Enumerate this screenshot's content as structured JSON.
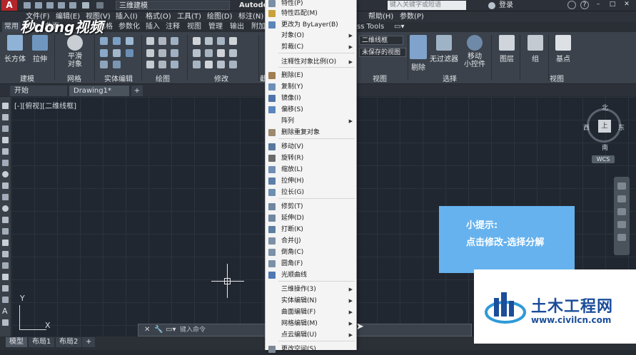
{
  "titlebar": {
    "app_logo": "A",
    "workspace": "三维建模",
    "app_title": "Autodesk",
    "search_placeholder": "键入关键字或短语",
    "login": "登录",
    "icons": [
      "new-file-icon",
      "open-icon",
      "save-icon",
      "save-as-icon",
      "print-icon",
      "undo-icon",
      "redo-icon"
    ]
  },
  "menubar": {
    "items": [
      "文件(F)",
      "编辑(E)",
      "视图(V)",
      "插入(I)",
      "格式(O)",
      "工具(T)",
      "绘图(D)",
      "标注(N)",
      "帮助(H)",
      "参数(P)"
    ]
  },
  "ribbon_tabs": {
    "items": [
      "常用",
      "实体",
      "曲面",
      "网格",
      "参数化",
      "插入",
      "注释",
      "视图",
      "管理",
      "输出",
      "附加"
    ],
    "trailing": "ss Tools"
  },
  "ribbon": {
    "buttons": {
      "box": "长方体",
      "extrude": "拉伸",
      "smooth": "平滑\n对象",
      "cut": "剖切",
      "no_filter": "无过滤器",
      "gizmo": "移动\n小控件",
      "layers": "图层",
      "group": "组",
      "base_point": "基点"
    },
    "panels": [
      "建模",
      "网格",
      "实体编辑",
      "绘图",
      "修改",
      "截",
      "视图",
      "选择",
      "视图"
    ],
    "visual_style": "二维线框",
    "saved_view": "未保存的视图"
  },
  "doctabs": {
    "start": "开始",
    "drawing": "Drawing1*",
    "new": "+"
  },
  "viewport": {
    "label": "[-][俯视][二维线框]",
    "compass": {
      "n": "北",
      "s": "南",
      "e": "东",
      "w": "西"
    },
    "cube_face": "上",
    "wcs": "WCS",
    "ucs_x": "X",
    "ucs_y": "Y"
  },
  "cmdline": {
    "placeholder": "键入命令"
  },
  "layout_tabs": {
    "items": [
      "模型",
      "布局1",
      "布局2",
      "+"
    ]
  },
  "tip": {
    "title": "小提示:",
    "text": "点击修改-选择分解"
  },
  "watermark": {
    "top_left": "秒dong视频",
    "site_name": "土木工程网",
    "site_url": "www.civilcn.com"
  },
  "context_menu": {
    "items": [
      {
        "label": "特性(P)",
        "icon": "properties-icon"
      },
      {
        "label": "特性匹配(M)",
        "icon": "match-properties-icon"
      },
      {
        "label": "更改为 ByLayer(B)",
        "icon": "bylayer-icon"
      },
      {
        "label": "对象(O)",
        "submenu": true
      },
      {
        "label": "剪裁(C)",
        "submenu": true
      },
      {
        "label": "注释性对象比例(O)",
        "submenu": true
      },
      {
        "label": "删除(E)",
        "icon": "erase-icon"
      },
      {
        "label": "复制(Y)",
        "icon": "copy-icon"
      },
      {
        "label": "镜像(I)",
        "icon": "mirror-icon"
      },
      {
        "label": "偏移(S)",
        "icon": "offset-icon"
      },
      {
        "label": "阵列",
        "submenu": true
      },
      {
        "label": "删除重复对象",
        "icon": "overkill-icon"
      },
      {
        "label": "移动(V)",
        "icon": "move-icon"
      },
      {
        "label": "旋转(R)",
        "icon": "rotate-icon"
      },
      {
        "label": "缩放(L)",
        "icon": "scale-icon"
      },
      {
        "label": "拉伸(H)",
        "icon": "stretch-icon"
      },
      {
        "label": "拉长(G)",
        "icon": "lengthen-icon"
      },
      {
        "label": "修剪(T)",
        "icon": "trim-icon"
      },
      {
        "label": "延伸(D)",
        "icon": "extend-icon"
      },
      {
        "label": "打断(K)",
        "icon": "break-icon"
      },
      {
        "label": "合并(J)",
        "icon": "join-icon"
      },
      {
        "label": "倒角(C)",
        "icon": "chamfer-icon"
      },
      {
        "label": "圆角(F)",
        "icon": "fillet-icon"
      },
      {
        "label": "光顺曲线",
        "icon": "blend-curves-icon"
      },
      {
        "label": "三维操作(3)",
        "submenu": true
      },
      {
        "label": "实体编辑(N)",
        "submenu": true
      },
      {
        "label": "曲面编辑(F)",
        "submenu": true
      },
      {
        "label": "网格编辑(M)",
        "submenu": true
      },
      {
        "label": "点云编辑(U)",
        "submenu": true
      },
      {
        "label": "更改空间(S)",
        "icon": "change-space-icon"
      }
    ]
  }
}
